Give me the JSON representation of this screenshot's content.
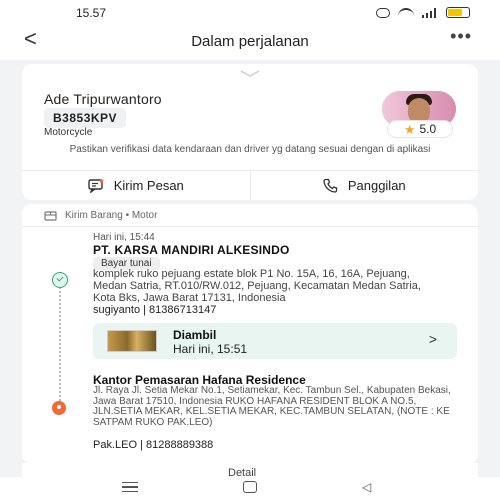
{
  "status_bar": {
    "time": "15.57"
  },
  "app_bar": {
    "back_glyph": "<",
    "title": "Dalam perjalanan",
    "more_glyph": "•••"
  },
  "driver": {
    "name": "Ade Tripurwantoro",
    "plate": "B3853KPV",
    "vehicle_type": "Motorcycle",
    "rating": "5.0",
    "verify_note": "Pastikan verifikasi data kendaraan dan driver yg datang sesuai dengan di aplikasi",
    "send_message_label": "Kirim Pesan",
    "call_label": "Panggilan"
  },
  "order": {
    "service_label": "Kirim Barang • Motor",
    "pickup": {
      "time": "Hari ini, 15:44",
      "name": "PT. KARSA MANDIRI ALKESINDO",
      "payment": "Bayar tunai",
      "address": "komplek ruko pejuang estate blok P1 No. 15A, 16, 16A, Pejuang, Medan Satria, RT.010/RW.012, Pejuang, Kecamatan Medan Satria, Kota Bks, Jawa Barat 17131, Indonesia",
      "contact": "sugiyanto | 81386713147"
    },
    "status": {
      "title": "Diambil",
      "time": "Hari ini, 15:51",
      "chevron": ">"
    },
    "dropoff": {
      "name": "Kantor Pemasaran Hafana Residence",
      "address": "Jl. Raya Jl. Setia Mekar No.1, Setiamekar, Kec. Tambun Sel., Kabupaten Bekasi, Jawa Barat 17510, Indonesia RUKO HAFANA RESIDENT BLOK A NO.5, JLN.SETIA MEKAR, KEL.SETIA MEKAR, KEC.TAMBUN SELATAN, (NOTE : KE SATPAM RUKO PAK.LEO)",
      "contact": "Pak.LEO | 81288889388"
    },
    "peek_text": "Detail"
  },
  "icons": {
    "status": [
      "dnd-icon",
      "wifi-icon",
      "signal-icon",
      "battery-icon"
    ],
    "driver": [
      "chat-icon",
      "phone-icon",
      "star-icon"
    ],
    "order": [
      "package-icon",
      "pickup-check-icon",
      "dropoff-pin-icon"
    ],
    "nav": [
      "recents-icon",
      "home-icon",
      "back-icon"
    ]
  },
  "colors": {
    "accent_green": "#2fa57a",
    "status_bg": "#e8f5f1",
    "dropoff_orange": "#f06a35",
    "rating_star": "#f5a623"
  }
}
